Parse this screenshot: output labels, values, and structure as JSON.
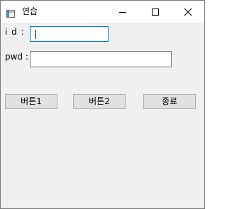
{
  "window": {
    "title": "연습"
  },
  "form": {
    "id_label": "i d :",
    "id_value": "",
    "pwd_label": "pwd :",
    "pwd_value": ""
  },
  "buttons": {
    "button1_label": "버튼1",
    "button2_label": "버튼2",
    "exit_label": "종료"
  }
}
